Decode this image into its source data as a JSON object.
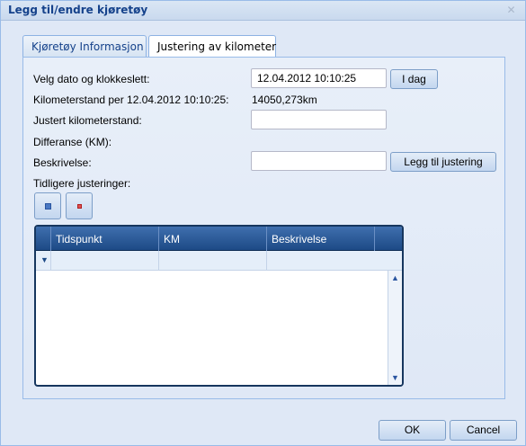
{
  "window": {
    "title": "Legg til/endre kjøretøy",
    "close_icon": "close-icon"
  },
  "tabs": [
    {
      "label": "Kjøretøy Informasjon",
      "active": false
    },
    {
      "label": "Justering av kilometer",
      "active": true
    }
  ],
  "form": {
    "date_label": "Velg dato og klokkeslett:",
    "date_value": "12.04.2012 10:10:25",
    "today_button": "I dag",
    "odometer_label": "Kilometerstand per 12.04.2012 10:10:25:",
    "odometer_value": "14050,273km",
    "adjusted_label": "Justert kilometerstand:",
    "adjusted_value": "",
    "difference_label": "Differanse (KM):",
    "description_label": "Beskrivelse:",
    "description_value": "",
    "add_adjustment_button": "Legg til justering",
    "previous_label": "Tidligere justeringer:"
  },
  "grid": {
    "columns": [
      "Tidspunkt",
      "KM",
      "Beskrivelse"
    ],
    "rows": []
  },
  "footer": {
    "ok_label": "OK",
    "cancel_label": "Cancel"
  },
  "colors": {
    "background": "#dfe8f6",
    "title_text": "#15428b",
    "grid_header": "#1d4a86",
    "border": "#99bbe8"
  }
}
